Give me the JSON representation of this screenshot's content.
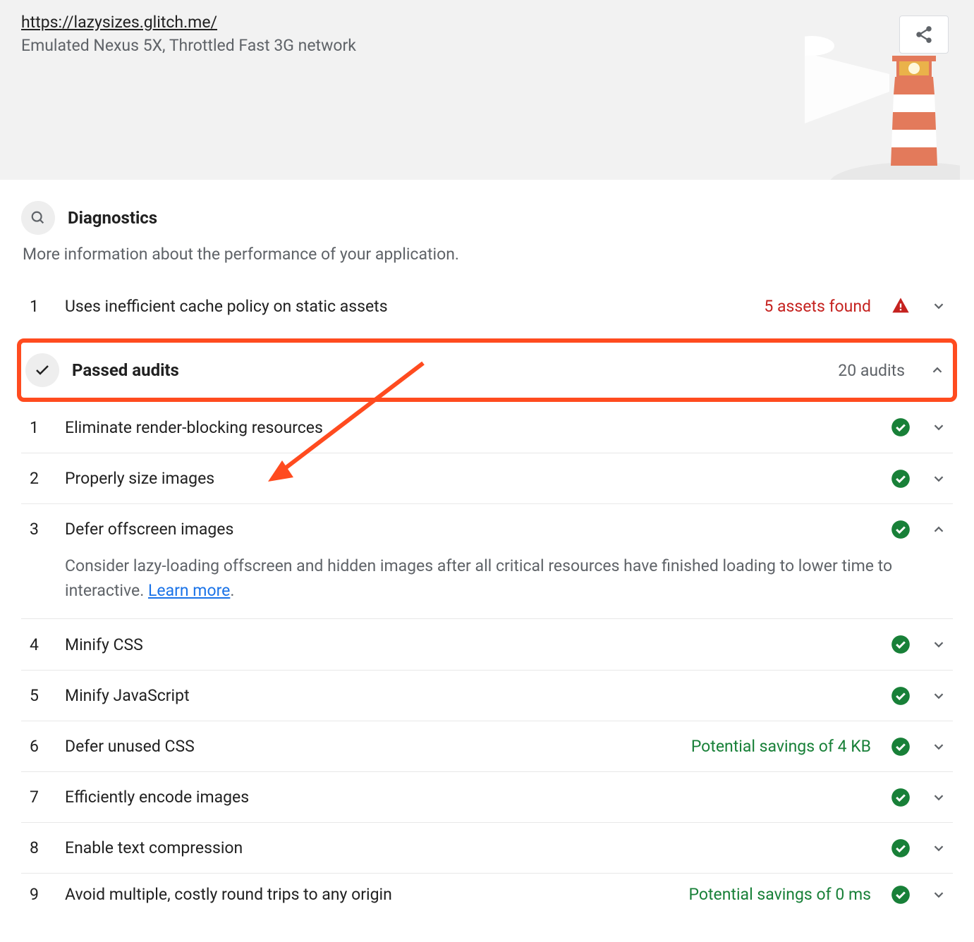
{
  "header": {
    "url": "https://lazysizes.glitch.me/",
    "subtitle": "Emulated Nexus 5X, Throttled Fast 3G network"
  },
  "diagnostics": {
    "title": "Diagnostics",
    "description": "More information about the performance of your application.",
    "items": [
      {
        "num": "1",
        "title": "Uses inefficient cache policy on static assets",
        "meta": "5 assets found",
        "meta_color": "red",
        "status": "warn",
        "expanded": false
      }
    ]
  },
  "passed": {
    "title": "Passed audits",
    "count_label": "20 audits",
    "items": [
      {
        "num": "1",
        "title": "Eliminate render-blocking resources",
        "meta": "",
        "status": "pass",
        "expanded": false
      },
      {
        "num": "2",
        "title": "Properly size images",
        "meta": "",
        "status": "pass",
        "expanded": false
      },
      {
        "num": "3",
        "title": "Defer offscreen images",
        "meta": "",
        "status": "pass",
        "expanded": true,
        "desc": "Consider lazy-loading offscreen and hidden images after all critical resources have finished loading to lower time to interactive. ",
        "learn_more": "Learn more"
      },
      {
        "num": "4",
        "title": "Minify CSS",
        "meta": "",
        "status": "pass",
        "expanded": false
      },
      {
        "num": "5",
        "title": "Minify JavaScript",
        "meta": "",
        "status": "pass",
        "expanded": false
      },
      {
        "num": "6",
        "title": "Defer unused CSS",
        "meta": "Potential savings of 4 KB",
        "meta_color": "green",
        "status": "pass",
        "expanded": false
      },
      {
        "num": "7",
        "title": "Efficiently encode images",
        "meta": "",
        "status": "pass",
        "expanded": false
      },
      {
        "num": "8",
        "title": "Enable text compression",
        "meta": "",
        "status": "pass",
        "expanded": false
      },
      {
        "num": "9",
        "title": "Avoid multiple, costly round trips to any origin",
        "meta": "Potential savings of 0 ms",
        "meta_color": "green",
        "status": "pass",
        "expanded": false
      }
    ]
  }
}
